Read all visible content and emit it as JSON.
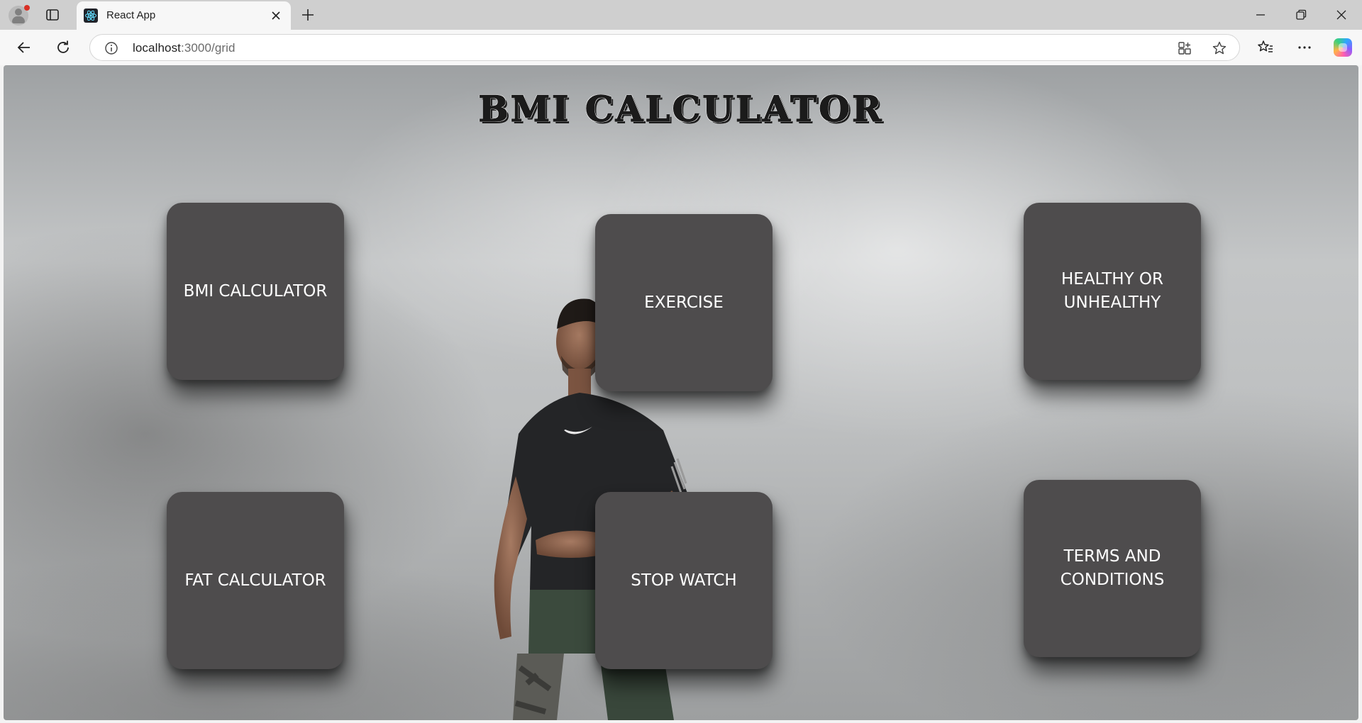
{
  "browser": {
    "tab_title": "React App",
    "url_host": "localhost",
    "url_path": ":3000/grid"
  },
  "page": {
    "title": "BMI CALCULATOR",
    "cards": [
      {
        "label": "BMI CALCULATOR"
      },
      {
        "label": "EXERCISE"
      },
      {
        "label": "HEALTHY OR UNHEALTHY"
      },
      {
        "label": "FAT CALCULATOR"
      },
      {
        "label": "STOP WATCH"
      },
      {
        "label": "TERMS AND CONDITIONS"
      }
    ],
    "colors": {
      "card_background": "#4e4c4d",
      "card_text": "#ffffff",
      "title_text": "#1b1b1b"
    }
  }
}
